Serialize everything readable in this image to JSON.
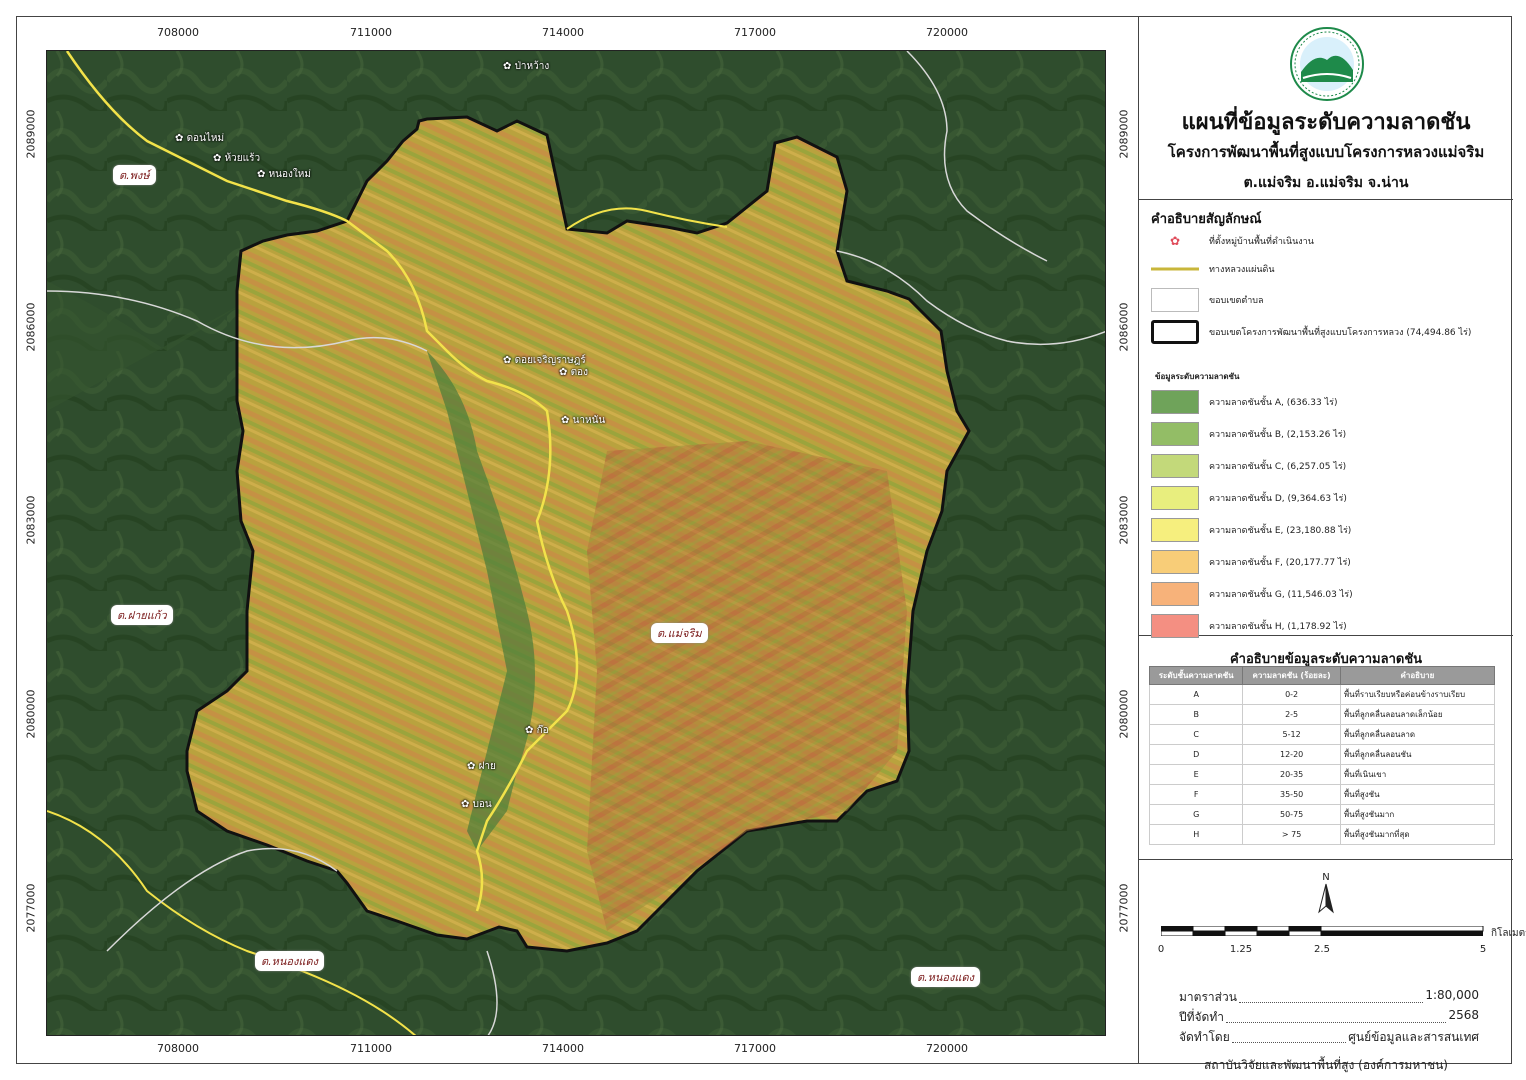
{
  "map": {
    "x_ticks": [
      "708000",
      "711000",
      "714000",
      "717000",
      "720000"
    ],
    "y_ticks": [
      "2089000",
      "2086000",
      "2083000",
      "2080000",
      "2077000"
    ],
    "villages": [
      {
        "name": "ป่าหว้าง"
      },
      {
        "name": "ดอนไหม่"
      },
      {
        "name": "ห้วยแร้ว"
      },
      {
        "name": "หนองใหม่"
      },
      {
        "name": "ดอยเจริญราษฎร์"
      },
      {
        "name": "ตอง"
      },
      {
        "name": "นาหนัน"
      },
      {
        "name": "ก๊อ"
      },
      {
        "name": "ฝาย"
      },
      {
        "name": "บอน"
      }
    ],
    "tambons": [
      {
        "name": "ต.พงษ์"
      },
      {
        "name": "ต.ฝายแก้ว"
      },
      {
        "name": "ต.แม่จริม"
      },
      {
        "name": "ต.หนองแดง"
      },
      {
        "name": "ต.หนองแดง"
      }
    ]
  },
  "title": {
    "main": "แผนที่ข้อมูลระดับความลาดชัน",
    "sub": "โครงการพัฒนาพื้นที่สูงแบบโครงการหลวงแม่จริม",
    "location": "ต.แม่จริม อ.แม่จริม จ.น่าน"
  },
  "legend": {
    "title": "คำอธิบายสัญลักษณ์",
    "village": "ที่ตั้งหมู่บ้านพื้นที่ดำเนินงาน",
    "road": "ทางหลวงแผ่นดิน",
    "tambon_boundary": "ขอบเขตตำบล",
    "project_boundary": "ขอบเขตโครงการพัฒนาพื้นที่สูงแบบโครงการหลวง (74,494.86 ไร่)",
    "slope_heading": "ข้อมูลระดับความลาดชัน",
    "classes": [
      {
        "label": "ความลาดชันชั้น A, (636.33 ไร่)",
        "color": "#6fa35a"
      },
      {
        "label": "ความลาดชันชั้น B, (2,153.26 ไร่)",
        "color": "#93bd66"
      },
      {
        "label": "ความลาดชันชั้น C, (6,257.05 ไร่)",
        "color": "#c3d97a"
      },
      {
        "label": "ความลาดชันชั้น D, (9,364.63 ไร่)",
        "color": "#e8ee7e"
      },
      {
        "label": "ความลาดชันชั้น E, (23,180.88 ไร่)",
        "color": "#f6ef7e"
      },
      {
        "label": "ความลาดชันชั้น F, (20,177.77 ไร่)",
        "color": "#f8cd78"
      },
      {
        "label": "ความลาดชันชั้น G, (11,546.03 ไร่)",
        "color": "#f7b27a"
      },
      {
        "label": "ความลาดชันชั้น H, (1,178.92 ไร่)",
        "color": "#f48f82"
      }
    ]
  },
  "slope_table": {
    "title": "คำอธิบายข้อมูลระดับความลาดชัน",
    "headers": [
      "ระดับชั้นความลาดชัน",
      "ความลาดชัน (ร้อยละ)",
      "คำอธิบาย"
    ],
    "rows": [
      [
        "A",
        "0-2",
        "พื้นที่ราบเรียบหรือค่อนข้างราบเรียบ"
      ],
      [
        "B",
        "2-5",
        "พื้นที่ลูกคลื่นลอนลาดเล็กน้อย"
      ],
      [
        "C",
        "5-12",
        "พื้นที่ลูกคลื่นลอนลาด"
      ],
      [
        "D",
        "12-20",
        "พื้นที่ลูกคลื่นลอนชัน"
      ],
      [
        "E",
        "20-35",
        "พื้นที่เนินเขา"
      ],
      [
        "F",
        "35-50",
        "พื้นที่สูงชัน"
      ],
      [
        "G",
        "50-75",
        "พื้นที่สูงชันมาก"
      ],
      [
        "H",
        "> 75",
        "พื้นที่สูงชันมากที่สุด"
      ]
    ]
  },
  "scale": {
    "north": "N",
    "labels": [
      "0",
      "1.25",
      "2.5",
      "5"
    ],
    "unit": "กิโลเมตร"
  },
  "info": {
    "scale_label": "มาตราส่วน",
    "scale_value": "1:80,000",
    "year_label": "ปีที่จัดทำ",
    "year_value": "2568",
    "by_label": "จัดทำโดย",
    "by_value": "ศูนย์ข้อมูลและสารสนเทศ",
    "institute": "สถาบันวิจัยและพัฒนาพื้นที่สูง (องค์การมหาชน)"
  },
  "colors": {
    "forest": "#2e4a2c",
    "project_fill": "#b7a03c",
    "road": "#f2e24a",
    "boundary": "#111111"
  }
}
